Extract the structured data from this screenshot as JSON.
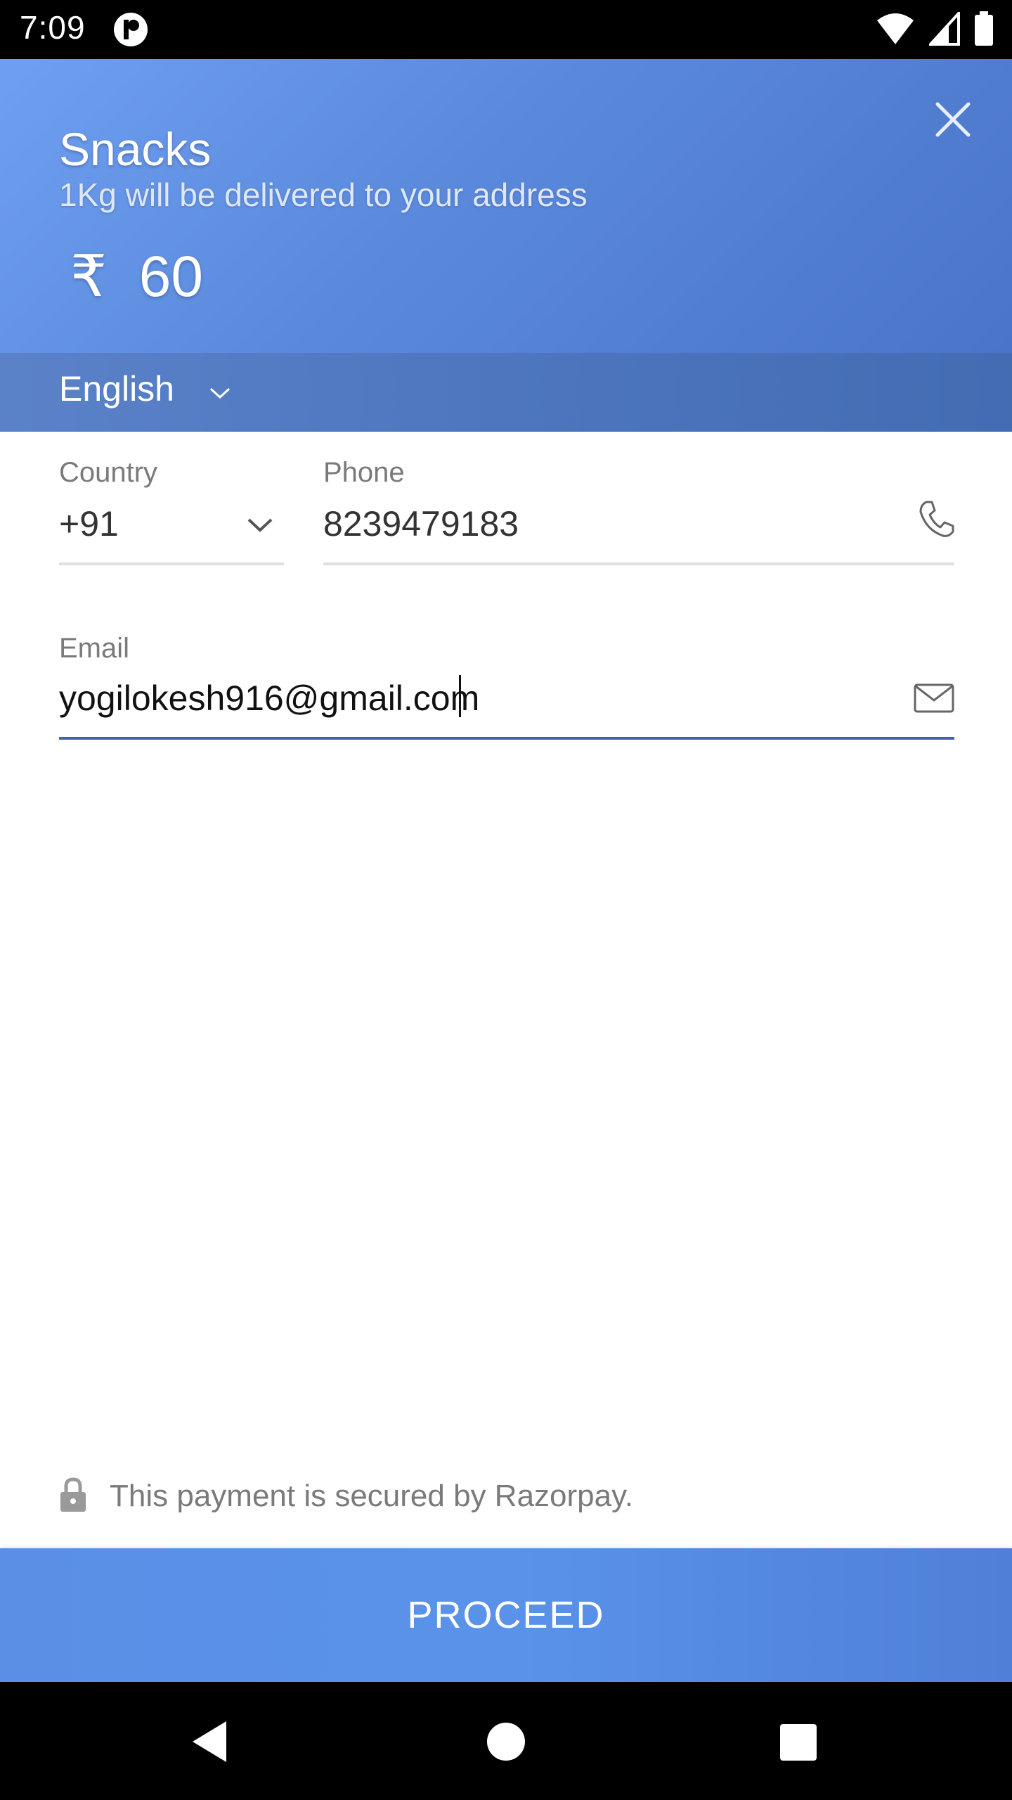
{
  "status_bar": {
    "time": "7:09"
  },
  "header": {
    "title": "Snacks",
    "description": "1Kg will be delivered to your address",
    "amount": "₹  60"
  },
  "language": {
    "selected": "English"
  },
  "form": {
    "country": {
      "label": "Country",
      "value": "+91"
    },
    "phone": {
      "label": "Phone",
      "value": "8239479183"
    },
    "email": {
      "label": "Email",
      "value": "yogilokesh916@gmail.com"
    }
  },
  "footer": {
    "secure_text": "This payment is secured by Razorpay.",
    "proceed_label": "PROCEED"
  },
  "colors": {
    "header_gradient_start": "#6f9ff0",
    "header_gradient_end": "#4a74c8",
    "active_underline": "#3d64b2",
    "proceed_button": "#5a92ea"
  }
}
